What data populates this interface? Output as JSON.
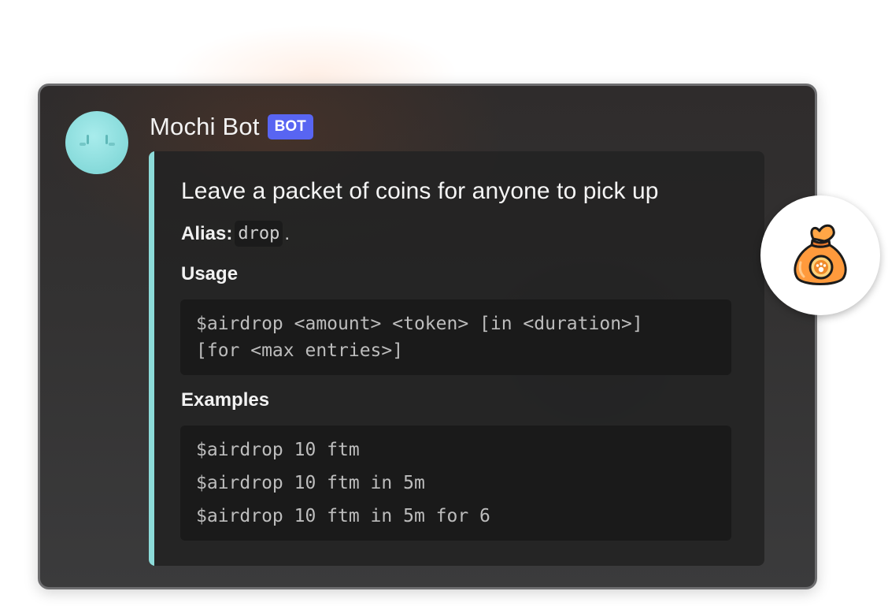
{
  "message": {
    "author": "Mochi Bot",
    "badge": "BOT",
    "avatar_icon": "mochi-face-icon"
  },
  "embed": {
    "accent_color": "#8cdbd9",
    "title": "Leave a packet of coins for anyone to pick up",
    "alias_label": "Alias:",
    "alias_value": "drop",
    "alias_suffix": ".",
    "usage_label": "Usage",
    "usage_lines": [
      "$airdrop <amount> <token> [in <duration>]",
      "[for <max entries>]"
    ],
    "examples_label": "Examples",
    "examples": [
      "$airdrop 10 ftm",
      "$airdrop 10 ftm in 5m",
      "$airdrop 10 ftm in 5m for 6"
    ]
  },
  "decoration": {
    "icon": "coin-bag-icon"
  },
  "colors": {
    "badge_bg": "#5865f2",
    "avatar": "#8fdcdc",
    "bag": "#ff9a3c"
  }
}
